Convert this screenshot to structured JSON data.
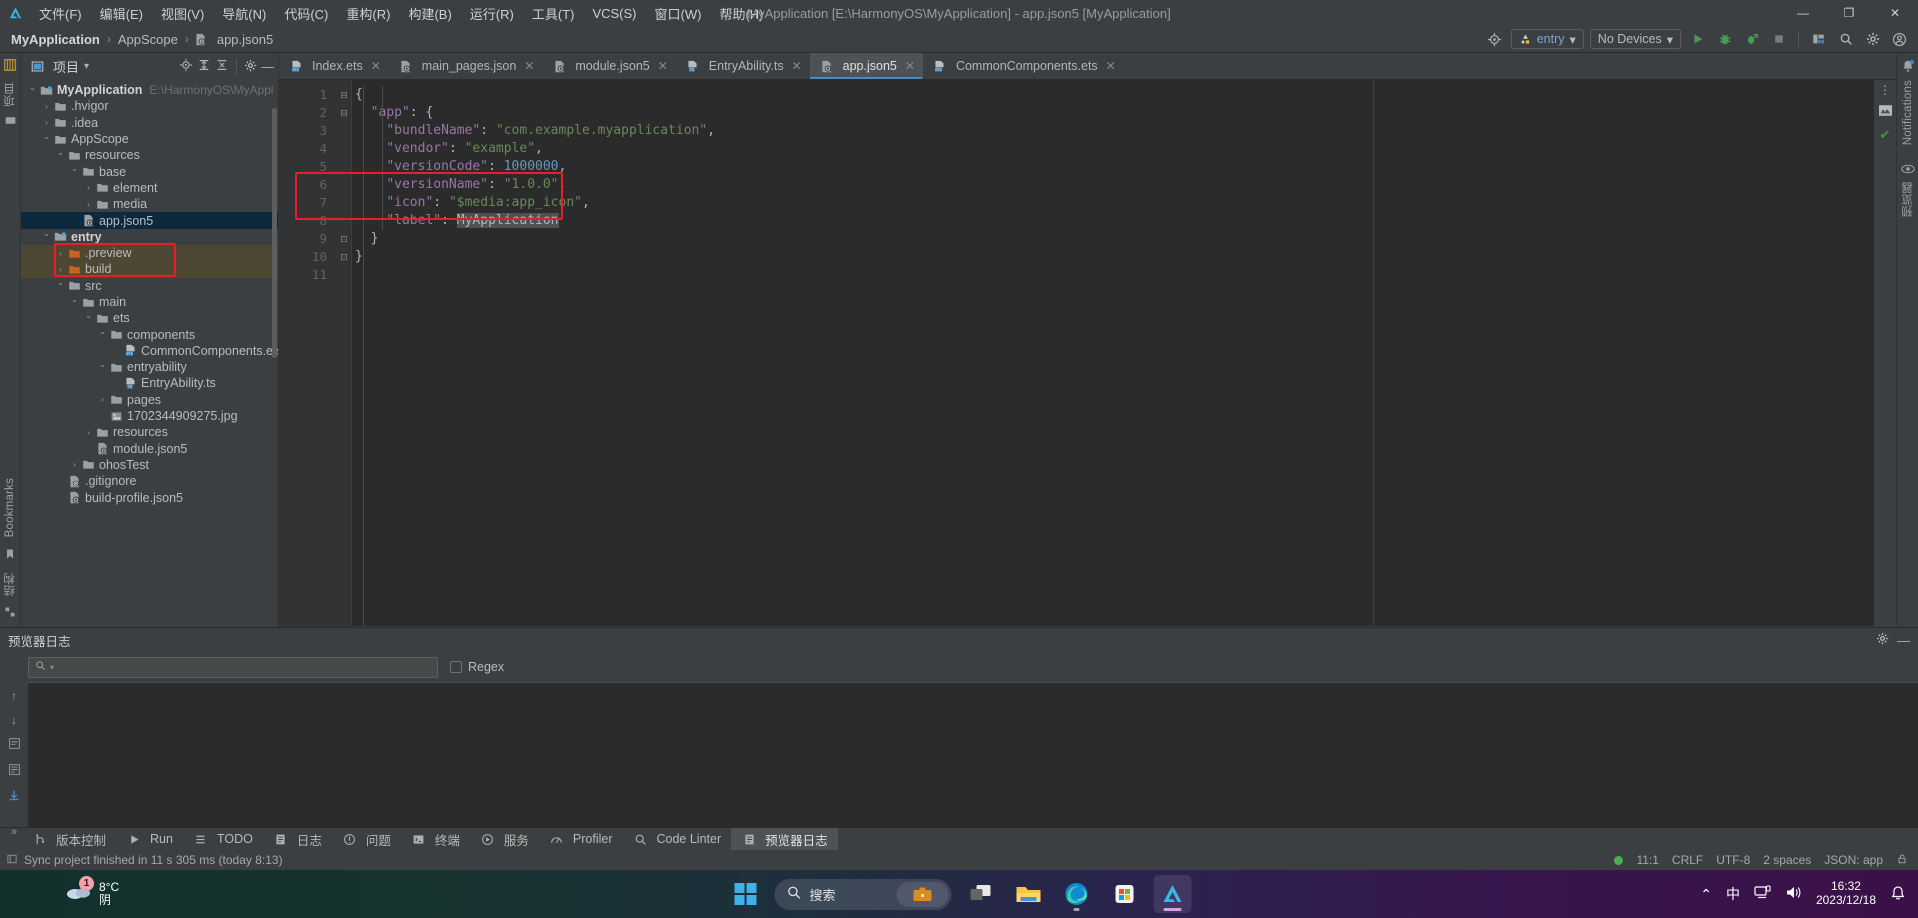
{
  "window": {
    "title": "MyApplication [E:\\HarmonyOS\\MyApplication] - app.json5 [MyApplication]",
    "minimize": "—",
    "maximize": "❐",
    "close": "✕"
  },
  "menubar": {
    "items": [
      {
        "label": "文件(F)",
        "name": "menu-file"
      },
      {
        "label": "编辑(E)",
        "name": "menu-edit"
      },
      {
        "label": "视图(V)",
        "name": "menu-view"
      },
      {
        "label": "导航(N)",
        "name": "menu-navigate"
      },
      {
        "label": "代码(C)",
        "name": "menu-code"
      },
      {
        "label": "重构(R)",
        "name": "menu-refactor"
      },
      {
        "label": "构建(B)",
        "name": "menu-build"
      },
      {
        "label": "运行(R)",
        "name": "menu-run"
      },
      {
        "label": "工具(T)",
        "name": "menu-tools"
      },
      {
        "label": "VCS(S)",
        "name": "menu-vcs"
      },
      {
        "label": "窗口(W)",
        "name": "menu-window"
      },
      {
        "label": "帮助(H)",
        "name": "menu-help"
      }
    ]
  },
  "breadcrumb": {
    "items": [
      "MyApplication",
      "AppScope",
      "app.json5"
    ],
    "separator": "›"
  },
  "run_toolbar": {
    "config_label": "entry",
    "device_label": "No Devices",
    "dropdown_caret": "▾"
  },
  "project_panel": {
    "title": "项目",
    "caret": "▾",
    "tree": [
      {
        "depth": 0,
        "arrow": "⌄",
        "icon": "module-icon",
        "label": "MyApplication",
        "bold": true,
        "path": "E:\\HarmonyOS\\MyApplicatio",
        "state": "normal"
      },
      {
        "depth": 1,
        "arrow": "›",
        "icon": "folder-icon",
        "label": ".hvigor",
        "state": "normal"
      },
      {
        "depth": 1,
        "arrow": "›",
        "icon": "folder-icon",
        "label": ".idea",
        "state": "normal"
      },
      {
        "depth": 1,
        "arrow": "⌄",
        "icon": "folder-icon",
        "label": "AppScope",
        "state": "normal"
      },
      {
        "depth": 2,
        "arrow": "⌄",
        "icon": "folder-icon",
        "label": "resources",
        "state": "normal"
      },
      {
        "depth": 3,
        "arrow": "⌄",
        "icon": "folder-icon",
        "label": "base",
        "state": "normal"
      },
      {
        "depth": 4,
        "arrow": "›",
        "icon": "folder-icon",
        "label": "element",
        "state": "normal"
      },
      {
        "depth": 4,
        "arrow": "›",
        "icon": "folder-icon",
        "label": "media",
        "state": "normal"
      },
      {
        "depth": 3,
        "arrow": "",
        "icon": "json5-icon",
        "label": "app.json5",
        "state": "selected"
      },
      {
        "depth": 1,
        "arrow": "⌄",
        "icon": "module-icon",
        "label": "entry",
        "bold": true,
        "state": "normal"
      },
      {
        "depth": 2,
        "arrow": "›",
        "icon": "folder-orange-icon",
        "label": ".preview",
        "state": "highlighted"
      },
      {
        "depth": 2,
        "arrow": "›",
        "icon": "folder-orange-icon",
        "label": "build",
        "state": "highlighted"
      },
      {
        "depth": 2,
        "arrow": "⌄",
        "icon": "folder-icon",
        "label": "src",
        "state": "normal"
      },
      {
        "depth": 3,
        "arrow": "⌄",
        "icon": "folder-icon",
        "label": "main",
        "state": "normal"
      },
      {
        "depth": 4,
        "arrow": "⌄",
        "icon": "folder-icon",
        "label": "ets",
        "state": "normal"
      },
      {
        "depth": 5,
        "arrow": "⌄",
        "icon": "folder-icon",
        "label": "components",
        "state": "normal"
      },
      {
        "depth": 6,
        "arrow": "",
        "icon": "ets-icon",
        "label": "CommonComponents.ets",
        "state": "normal"
      },
      {
        "depth": 5,
        "arrow": "⌄",
        "icon": "folder-icon",
        "label": "entryability",
        "state": "normal"
      },
      {
        "depth": 6,
        "arrow": "",
        "icon": "ts-icon",
        "label": "EntryAbility.ts",
        "state": "normal"
      },
      {
        "depth": 5,
        "arrow": "›",
        "icon": "folder-icon",
        "label": "pages",
        "state": "normal"
      },
      {
        "depth": 5,
        "arrow": "",
        "icon": "image-icon",
        "label": "1702344909275.jpg",
        "state": "normal"
      },
      {
        "depth": 4,
        "arrow": "›",
        "icon": "folder-icon",
        "label": "resources",
        "state": "normal"
      },
      {
        "depth": 4,
        "arrow": "",
        "icon": "json5-icon",
        "label": "module.json5",
        "state": "normal"
      },
      {
        "depth": 3,
        "arrow": "›",
        "icon": "folder-icon",
        "label": "ohosTest",
        "state": "normal"
      },
      {
        "depth": 2,
        "arrow": "",
        "icon": "gitignore-icon",
        "label": ".gitignore",
        "state": "normal"
      },
      {
        "depth": 2,
        "arrow": "",
        "icon": "json5-icon",
        "label": "build-profile.json5",
        "state": "normal"
      }
    ]
  },
  "editor": {
    "tabs": [
      {
        "label": "Index.ets",
        "icon": "ets-icon",
        "active": false,
        "close": "✕"
      },
      {
        "label": "main_pages.json",
        "icon": "json-icon",
        "active": false,
        "close": "✕"
      },
      {
        "label": "module.json5",
        "icon": "json5-icon",
        "active": false,
        "close": "✕"
      },
      {
        "label": "EntryAbility.ts",
        "icon": "ts-icon",
        "active": false,
        "close": "✕"
      },
      {
        "label": "app.json5",
        "icon": "json5-icon",
        "active": true,
        "close": "✕"
      },
      {
        "label": "CommonComponents.ets",
        "icon": "ets-icon",
        "active": false,
        "close": "✕"
      }
    ],
    "line_numbers": [
      "1",
      "2",
      "3",
      "4",
      "5",
      "6",
      "7",
      "8",
      "9",
      "10",
      "11"
    ],
    "lines": [
      [
        {
          "t": "{",
          "c": "punct"
        }
      ],
      [
        {
          "t": "  ",
          "c": "plain"
        },
        {
          "t": "\"app\"",
          "c": "key"
        },
        {
          "t": ": {",
          "c": "punct"
        }
      ],
      [
        {
          "t": "    ",
          "c": "plain"
        },
        {
          "t": "\"bundleName\"",
          "c": "key"
        },
        {
          "t": ": ",
          "c": "punct"
        },
        {
          "t": "\"com.example.myapplication\"",
          "c": "str"
        },
        {
          "t": ",",
          "c": "punct"
        }
      ],
      [
        {
          "t": "    ",
          "c": "plain"
        },
        {
          "t": "\"vendor\"",
          "c": "key"
        },
        {
          "t": ": ",
          "c": "punct"
        },
        {
          "t": "\"example\"",
          "c": "str"
        },
        {
          "t": ",",
          "c": "punct"
        }
      ],
      [
        {
          "t": "    ",
          "c": "plain"
        },
        {
          "t": "\"versionCode\"",
          "c": "key"
        },
        {
          "t": ": ",
          "c": "punct"
        },
        {
          "t": "1000000",
          "c": "num"
        },
        {
          "t": ",",
          "c": "punct"
        }
      ],
      [
        {
          "t": "    ",
          "c": "plain"
        },
        {
          "t": "\"versionName\"",
          "c": "key"
        },
        {
          "t": ": ",
          "c": "punct"
        },
        {
          "t": "\"1.0.0\"",
          "c": "str"
        },
        {
          "t": ",",
          "c": "punct"
        }
      ],
      [
        {
          "t": "    ",
          "c": "plain"
        },
        {
          "t": "\"icon\"",
          "c": "key"
        },
        {
          "t": ": ",
          "c": "punct"
        },
        {
          "t": "\"$media:app_icon\"",
          "c": "str"
        },
        {
          "t": ",",
          "c": "punct"
        }
      ],
      [
        {
          "t": "    ",
          "c": "plain"
        },
        {
          "t": "\"label\"",
          "c": "key"
        },
        {
          "t": ": ",
          "c": "punct"
        },
        {
          "t": "MyApplication",
          "c": "selected"
        }
      ],
      [
        {
          "t": "  }",
          "c": "punct"
        }
      ],
      [
        {
          "t": "}",
          "c": "punct"
        }
      ],
      []
    ]
  },
  "bottom_panel": {
    "title": "预览器日志",
    "search_placeholder": "",
    "search_value": "",
    "regex_label": "Regex"
  },
  "bottom_tabs": [
    {
      "label": "版本控制",
      "icon": "vcs-icon",
      "active": false
    },
    {
      "label": "Run",
      "icon": "run-icon",
      "active": false
    },
    {
      "label": "TODO",
      "icon": "todo-icon",
      "active": false
    },
    {
      "label": "日志",
      "icon": "log-icon",
      "active": false
    },
    {
      "label": "问题",
      "icon": "problems-icon",
      "active": false
    },
    {
      "label": "终端",
      "icon": "terminal-icon",
      "active": false
    },
    {
      "label": "服务",
      "icon": "services-icon",
      "active": false
    },
    {
      "label": "Profiler",
      "icon": "profiler-icon",
      "active": false
    },
    {
      "label": "Code Linter",
      "icon": "linter-icon",
      "active": false
    },
    {
      "label": "预览器日志",
      "icon": "preview-log-icon",
      "active": true
    }
  ],
  "statusbar": {
    "message": "Sync project finished in 11 s 305 ms (today 8:13)",
    "caret": "11:1",
    "line_ending": "CRLF",
    "encoding": "UTF-8",
    "indent": "2 spaces",
    "scheme": "JSON: app"
  },
  "side_strips": {
    "left_bottom_label": "Bookmarks",
    "left_bottom_label2": "结构",
    "right_label": "Notifications",
    "right_label2": "预览器"
  },
  "taskbar": {
    "weather_temp": "8°C",
    "weather_desc": "阴",
    "weather_badge": "1",
    "search_placeholder": "搜索",
    "apps": [
      {
        "name": "start-button",
        "icon": "windows-icon"
      },
      {
        "name": "taskview-button",
        "icon": "task-view-icon"
      },
      {
        "name": "file-explorer-button",
        "icon": "folder-icon"
      },
      {
        "name": "edge-button",
        "icon": "edge-icon"
      },
      {
        "name": "store-button",
        "icon": "microsoft-store-icon"
      },
      {
        "name": "deveco-button",
        "icon": "deveco-studio-icon"
      }
    ],
    "tray": {
      "chevron": "⌃",
      "ime": "中",
      "time": "16:32",
      "date": "2023/12/18"
    }
  },
  "colors": {
    "accent": "#4a88c7",
    "selection": "#0d293e",
    "highlight": "#4e4733",
    "red_box": "#ee1c25",
    "green": "#4caf50"
  }
}
